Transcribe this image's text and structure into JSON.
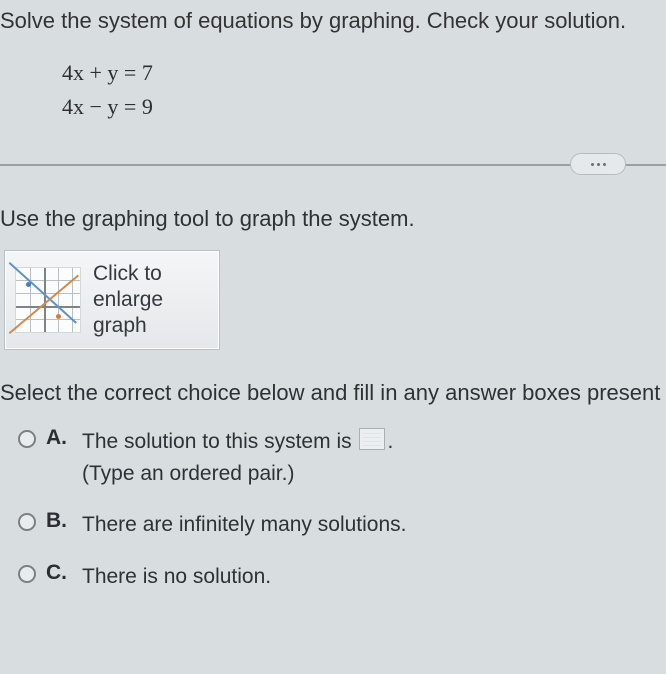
{
  "prompt": "Solve the system of equations by graphing.  Check your solution.",
  "equations": {
    "eq1": "4x + y  =  7",
    "eq2": "4x − y  =  9"
  },
  "graph_instruction": "Use the graphing tool to graph the system.",
  "graph_button": {
    "line1": "Click to",
    "line2": "enlarge",
    "line3": "graph"
  },
  "select_prompt": "Select the correct choice below and fill in any answer boxes present",
  "choices": {
    "a": {
      "letter": "A.",
      "text_before": "The solution to this system is ",
      "text_after": ".",
      "hint": "(Type an ordered pair.)"
    },
    "b": {
      "letter": "B.",
      "text": "There are infinitely many solutions."
    },
    "c": {
      "letter": "C.",
      "text": "There is no solution."
    }
  }
}
